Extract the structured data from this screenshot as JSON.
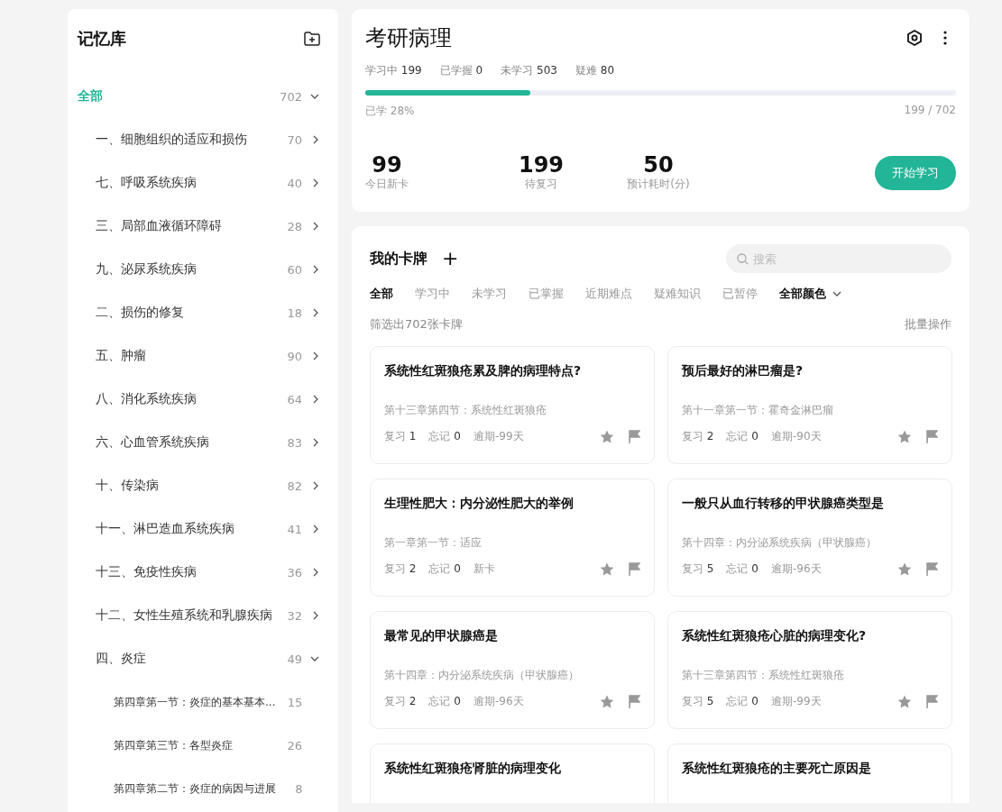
{
  "sidebar": {
    "title": "记忆库",
    "items": [
      {
        "label": "全部",
        "count": "702",
        "selected": true,
        "expanded": true,
        "children": [
          {
            "label": "一、细胞组织的适应和损伤",
            "count": "70",
            "selected": false,
            "expanded": false
          },
          {
            "label": "七、呼吸系统疾病",
            "count": "40",
            "selected": false,
            "expanded": false
          },
          {
            "label": "三、局部血液循环障碍",
            "count": "28",
            "selected": false,
            "expanded": false
          },
          {
            "label": "九、泌尿系统疾病",
            "count": "60",
            "selected": false,
            "expanded": false
          },
          {
            "label": "二、损伤的修复",
            "count": "18",
            "selected": false,
            "expanded": false
          },
          {
            "label": "五、肿瘤",
            "count": "90",
            "selected": false,
            "expanded": false
          },
          {
            "label": "八、消化系统疾病",
            "count": "64",
            "selected": false,
            "expanded": false
          },
          {
            "label": "六、心血管系统疾病",
            "count": "83",
            "selected": false,
            "expanded": false
          },
          {
            "label": "十、传染病",
            "count": "82",
            "selected": false,
            "expanded": false
          },
          {
            "label": "十一、淋巴造血系统疾病",
            "count": "41",
            "selected": false,
            "expanded": false
          },
          {
            "label": "十三、免疫性疾病",
            "count": "36",
            "selected": false,
            "expanded": false
          },
          {
            "label": "十二、女性生殖系统和乳腺疾病",
            "count": "32",
            "selected": false,
            "expanded": false
          },
          {
            "label": "四、炎症",
            "count": "49",
            "selected": false,
            "expanded": true,
            "children": [
              {
                "label": "第四章第一节：炎症的基本基本...",
                "count": "15",
                "selected": false
              },
              {
                "label": "第四章第三节：各型炎症",
                "count": "26",
                "selected": false
              },
              {
                "label": "第四章第二节：炎症的病因与进展",
                "count": "8",
                "selected": false
              }
            ]
          }
        ]
      }
    ]
  },
  "deck": {
    "title": "考研病理",
    "stats": [
      {
        "label": "学习中",
        "value": "199"
      },
      {
        "label": "已学握",
        "value": "0"
      },
      {
        "label": "未学习",
        "value": "503"
      },
      {
        "label": "疑难",
        "value": "80"
      }
    ],
    "progress": {
      "level": 0.28,
      "caption": "已学 28%",
      "fraction": "199 / 702"
    },
    "summary": [
      {
        "value": "99",
        "label": "今日新卡"
      },
      {
        "value": "199",
        "label": "待复习"
      },
      {
        "value": "50",
        "label": "预计耗时(分)"
      }
    ],
    "start_button": "开始学习"
  },
  "cards_panel": {
    "title": "我的卡牌",
    "add_icon": "+",
    "search": {
      "placeholder": "搜索"
    },
    "filters": [
      {
        "label": "全部",
        "selected": true
      },
      {
        "label": "学习中",
        "selected": false
      },
      {
        "label": "未学习",
        "selected": false
      },
      {
        "label": "已掌握",
        "selected": false
      },
      {
        "label": "近期难点",
        "selected": false
      },
      {
        "label": "疑难知识",
        "selected": false
      },
      {
        "label": "已暂停",
        "selected": false
      }
    ],
    "color_filter": "全部颜色",
    "result_count": "筛选出702张卡牌",
    "batch_action": "批量操作",
    "cards": [
      {
        "title": "系统性红斑狼疮累及脾的病理特点?",
        "chapter": "第十三章第四节：系统性红斑狼疮",
        "stats": [
          {
            "label": "复习",
            "value": "1"
          },
          {
            "label": "忘记",
            "value": "0"
          },
          {
            "label": "逾期-99天"
          }
        ]
      },
      {
        "title": "预后最好的淋巴瘤是?",
        "chapter": "第十一章第一节：霍奇金淋巴瘤",
        "stats": [
          {
            "label": "复习",
            "value": "2"
          },
          {
            "label": "忘记",
            "value": "0"
          },
          {
            "label": "逾期-90天"
          }
        ]
      },
      {
        "title": "生理性肥大：内分泌性肥大的举例",
        "chapter": "第一章第一节：适应",
        "stats": [
          {
            "label": "复习",
            "value": "2"
          },
          {
            "label": "忘记",
            "value": "0"
          },
          {
            "label": "新卡"
          }
        ]
      },
      {
        "title": "一般只从血行转移的甲状腺癌类型是",
        "chapter": "第十四章：内分泌系统疾病（甲状腺癌）",
        "stats": [
          {
            "label": "复习",
            "value": "5"
          },
          {
            "label": "忘记",
            "value": "0"
          },
          {
            "label": "逾期-96天"
          }
        ]
      },
      {
        "title": "最常见的甲状腺癌是",
        "chapter": "第十四章：内分泌系统疾病（甲状腺癌）",
        "stats": [
          {
            "label": "复习",
            "value": "2"
          },
          {
            "label": "忘记",
            "value": "0"
          },
          {
            "label": "逾期-96天"
          }
        ]
      },
      {
        "title": "系统性红斑狼疮心脏的病理变化?",
        "chapter": "第十三章第四节：系统性红斑狼疮",
        "stats": [
          {
            "label": "复习",
            "value": "5"
          },
          {
            "label": "忘记",
            "value": "0"
          },
          {
            "label": "逾期-99天"
          }
        ]
      },
      {
        "title": "系统性红斑狼疮肾脏的病理变化"
      },
      {
        "title": "系统性红斑狼疮的主要死亡原因是"
      }
    ]
  }
}
